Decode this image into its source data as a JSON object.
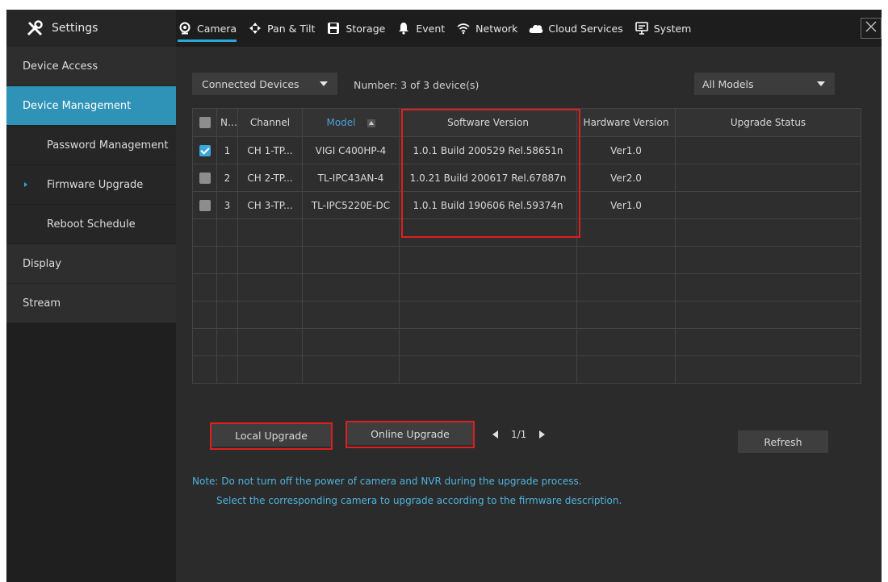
{
  "header": {
    "settings_label": "Settings",
    "tabs": [
      {
        "label": "Camera",
        "icon": "camera-icon"
      },
      {
        "label": "Pan & Tilt",
        "icon": "pan-tilt-icon"
      },
      {
        "label": "Storage",
        "icon": "storage-icon"
      },
      {
        "label": "Event",
        "icon": "bell-icon"
      },
      {
        "label": "Network",
        "icon": "wifi-icon"
      },
      {
        "label": "Cloud Services",
        "icon": "cloud-icon"
      },
      {
        "label": "System",
        "icon": "monitor-icon"
      }
    ],
    "active_tab": "Camera"
  },
  "sidebar": {
    "items": [
      {
        "label": "Device Access"
      },
      {
        "label": "Device Management"
      },
      {
        "label": "Password Management"
      },
      {
        "label": "Firmware Upgrade"
      },
      {
        "label": "Reboot Schedule"
      },
      {
        "label": "Display"
      },
      {
        "label": "Stream"
      }
    ]
  },
  "filters": {
    "device_filter": "Connected Devices",
    "number_text": "Number: 3 of 3 device(s)",
    "model_filter": "All Models"
  },
  "table": {
    "headers": {
      "no": "No.",
      "channel": "Channel",
      "model": "Model",
      "software": "Software Version",
      "hardware": "Hardware Version",
      "status": "Upgrade Status"
    },
    "rows": [
      {
        "no": "1",
        "channel": "CH 1-TP...",
        "model": "VIGI C400HP-4",
        "software": "1.0.1 Build 200529 Rel.58651n",
        "hardware": "Ver1.0",
        "status": "",
        "checked": true
      },
      {
        "no": "2",
        "channel": "CH 2-TP...",
        "model": "TL-IPC43AN-4",
        "software": "1.0.21 Build 200617 Rel.67887n",
        "hardware": "Ver2.0",
        "status": "",
        "checked": false
      },
      {
        "no": "3",
        "channel": "CH 3-TP...",
        "model": "TL-IPC5220E-DC",
        "software": "1.0.1 Build 190606 Rel.59374n",
        "hardware": "Ver1.0",
        "status": "",
        "checked": false
      }
    ]
  },
  "actions": {
    "local_upgrade": "Local Upgrade",
    "online_upgrade": "Online Upgrade",
    "page": "1/1",
    "refresh": "Refresh"
  },
  "note": {
    "line1": "Note: Do not turn off the power of camera and NVR during the upgrade process.",
    "line2": "Select the corresponding camera to upgrade according to the firmware description."
  },
  "colors": {
    "accent": "#2aa7d9",
    "highlight": "#e01e1e"
  }
}
